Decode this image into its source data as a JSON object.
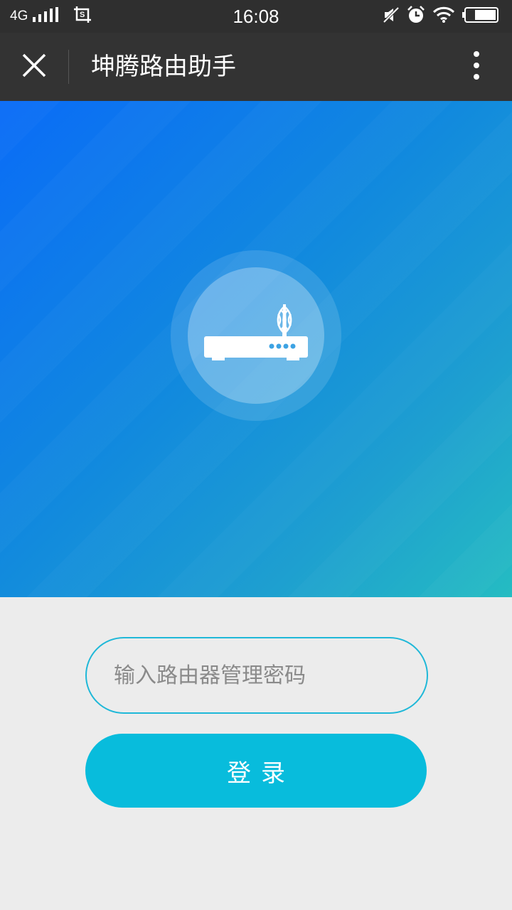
{
  "status_bar": {
    "network": "4G",
    "time": "16:08",
    "icons": [
      "signal-icon",
      "screenshot-icon",
      "mute-icon",
      "alarm-icon",
      "wifi-icon",
      "battery-icon"
    ]
  },
  "nav": {
    "title": "坤腾路由助手",
    "close_icon": "close-icon",
    "more_icon": "more-vertical-icon"
  },
  "hero": {
    "icon": "router-icon",
    "gradient_colors": [
      "#0a6cf7",
      "#1189de",
      "#25bcc2"
    ]
  },
  "login": {
    "password_placeholder": "输入路由器管理密码",
    "password_value": "",
    "button_label": "登录"
  },
  "colors": {
    "accent": "#08bcdc",
    "input_border": "#1fb8d8",
    "nav_bg": "#333333"
  }
}
